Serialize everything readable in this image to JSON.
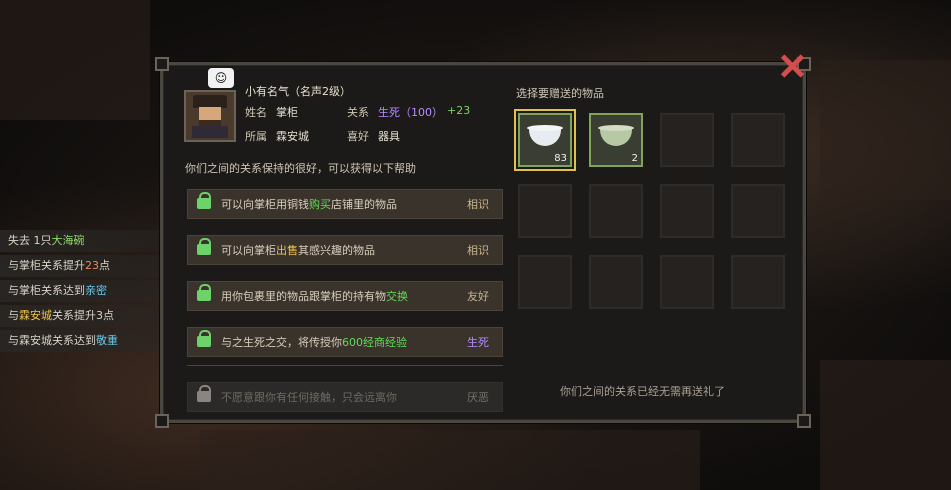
{
  "npc": {
    "title": "小有名气（名声2级）",
    "name_label": "姓名",
    "name": "掌柜",
    "relation_label": "关系",
    "relation": "生死（100）",
    "relation_delta": "+23",
    "faction_label": "所属",
    "faction": "霖安城",
    "hobby_label": "喜好",
    "hobby": "器具",
    "speech_bubble": "☺"
  },
  "benefits_intro": "你们之间的关系保持的很好，可以获得以下帮助",
  "benefits": [
    {
      "pre": "可以向掌柜用铜钱",
      "hl": "购买",
      "post": "店铺里的物品",
      "tag": "相识"
    },
    {
      "pre": "可以向掌柜",
      "hl": "出售",
      "post": "其感兴趣的物品",
      "tag": "相识"
    },
    {
      "pre": "用你包裹里的物品跟掌柜的持有物",
      "hl": "交换",
      "post": "",
      "tag": "友好"
    },
    {
      "pre": "与之生死之交，将传授你",
      "hl": "600经商经验",
      "post": "",
      "tag": "生死"
    },
    {
      "pre": "不愿意跟你有任何接触，只会远离你",
      "hl": "",
      "post": "",
      "tag": "厌恶"
    }
  ],
  "gift": {
    "title": "选择要赠送的物品",
    "items": [
      {
        "icon": "white-bowl-icon",
        "count": "83"
      },
      {
        "icon": "green-bowl-icon",
        "count": "2"
      }
    ],
    "footer": "你们之间的关系已经无需再送礼了"
  },
  "log": {
    "lines": [
      {
        "a": "失去 1只",
        "b": "大海碗",
        "c": ""
      },
      {
        "a": "与掌柜关系提升",
        "b": "23",
        "c": "点"
      },
      {
        "a": "与掌柜关系达到",
        "b": "亲密",
        "c": ""
      },
      {
        "a": "与",
        "b": "霖安城",
        "c": "关系提升3点"
      },
      {
        "a": "与霖安城关系达到",
        "b": "敬重",
        "c": ""
      }
    ]
  }
}
